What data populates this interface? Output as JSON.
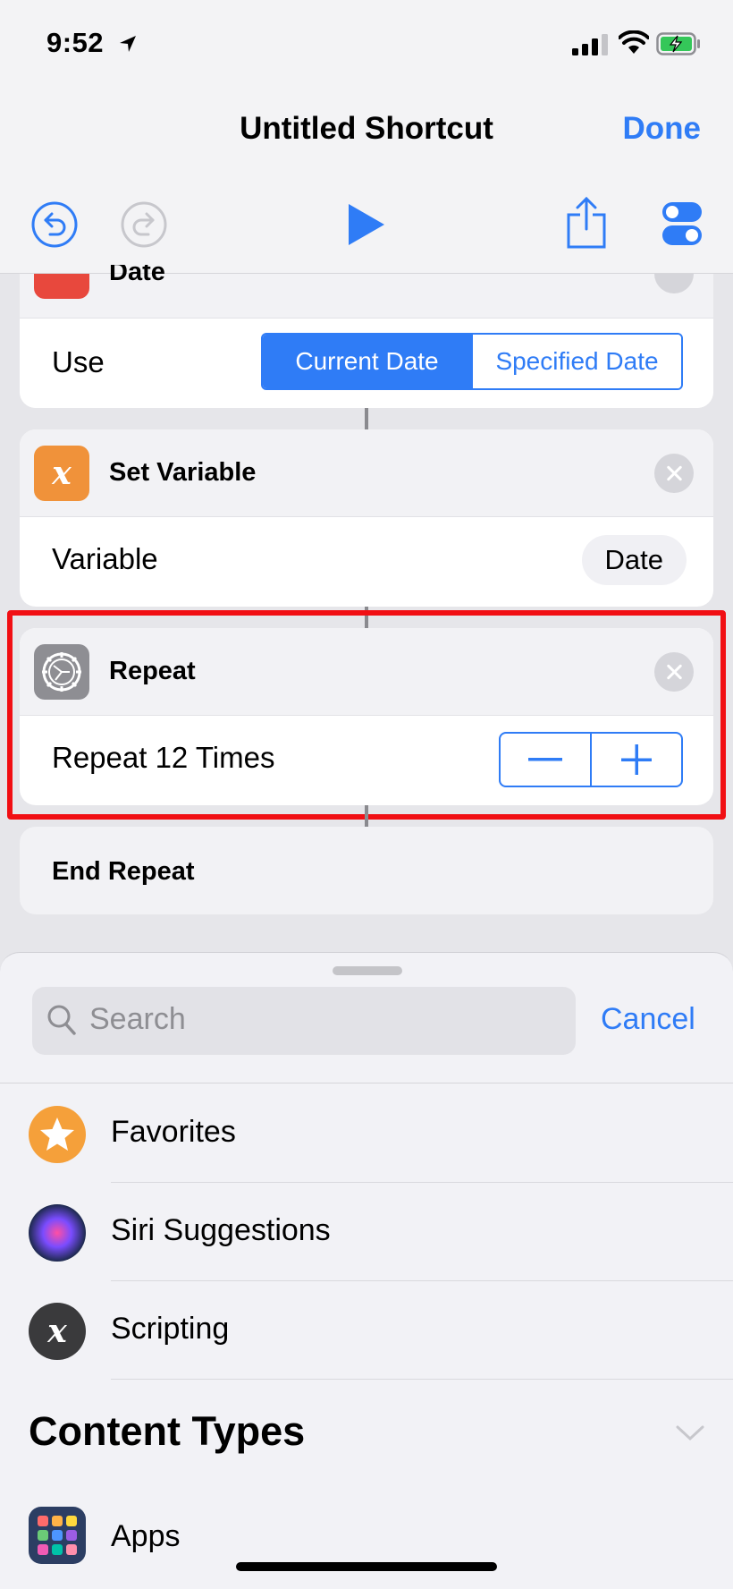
{
  "status_bar": {
    "time": "9:52"
  },
  "nav": {
    "title": "Untitled Shortcut",
    "done_label": "Done"
  },
  "actions": {
    "date": {
      "title": "Date",
      "row_label": "Use",
      "options": [
        "Current Date",
        "Specified Date"
      ],
      "selected": "Current Date"
    },
    "set_variable": {
      "title": "Set Variable",
      "row_label": "Variable",
      "value": "Date"
    },
    "repeat": {
      "title": "Repeat",
      "row_label": "Repeat 12 Times"
    },
    "end_repeat": {
      "title": "End Repeat"
    }
  },
  "sheet": {
    "search_placeholder": "Search",
    "cancel_label": "Cancel",
    "items": [
      {
        "label": "Favorites",
        "icon": "star-icon"
      },
      {
        "label": "Siri Suggestions",
        "icon": "siri-icon"
      },
      {
        "label": "Scripting",
        "icon": "scripting-icon"
      }
    ],
    "section_title": "Content Types",
    "content_items": [
      {
        "label": "Apps",
        "icon": "apps-icon"
      }
    ]
  },
  "colors": {
    "accent": "#2f7cf6",
    "highlight": "#f10f14",
    "date_icon": "#e8483d",
    "variable_icon": "#f0923a",
    "favorites_icon": "#f5a03a"
  }
}
